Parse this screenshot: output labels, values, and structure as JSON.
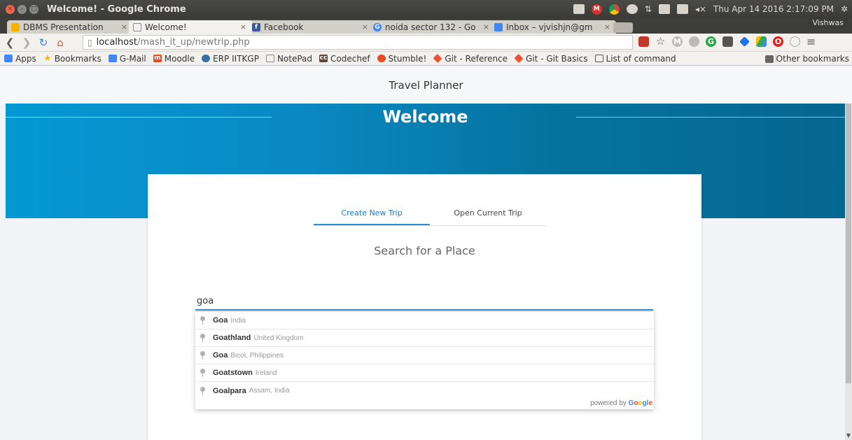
{
  "os": {
    "window_title": "Welcome! - Google Chrome",
    "clock": "Thu Apr 14 2016 2:17:09 PM",
    "user": "Vishwas"
  },
  "browser": {
    "tabs": [
      {
        "label": "DBMS Presentation",
        "favicon": "slides-icon",
        "color": "#f4b400"
      },
      {
        "label": "Welcome!",
        "favicon": "page-icon",
        "color": "#888888"
      },
      {
        "label": "Facebook",
        "favicon": "facebook-icon",
        "color": "#3b5998"
      },
      {
        "label": "noida sector 132 - Go",
        "favicon": "google-icon",
        "color": "#4285f4"
      },
      {
        "label": "Inbox – vjvishjn@gm",
        "favicon": "inbox-icon",
        "color": "#4285f4"
      }
    ],
    "url_host": "localhost",
    "url_path": "/mash_it_up/newtrip.php",
    "bookmarks": [
      {
        "label": "Apps",
        "icon": "apps-icon",
        "color": "#4285f4"
      },
      {
        "label": "Bookmarks",
        "icon": "star-icon",
        "color": "#f4b400"
      },
      {
        "label": "G-Mail",
        "icon": "gmail-icon",
        "color": "#4285f4"
      },
      {
        "label": "Moodle",
        "icon": "moodle-icon",
        "color": "#e04e2d"
      },
      {
        "label": "ERP IITKGP",
        "icon": "erp-icon",
        "color": "#3a6ea5"
      },
      {
        "label": "NotePad",
        "icon": "page-icon",
        "color": "#888888"
      },
      {
        "label": "Codechef",
        "icon": "codechef-icon",
        "color": "#5b4638"
      },
      {
        "label": "Stumble!",
        "icon": "stumble-icon",
        "color": "#eb4924"
      },
      {
        "label": "Git - Reference",
        "icon": "git-icon",
        "color": "#f05033"
      },
      {
        "label": "Git - Git Basics",
        "icon": "git-icon",
        "color": "#f05033"
      },
      {
        "label": "List of command",
        "icon": "list-icon",
        "color": "#555555"
      }
    ],
    "other_bookmarks": "Other bookmarks"
  },
  "page": {
    "app_title": "Travel Planner",
    "hero_title": "Welcome",
    "tabs": [
      {
        "label": "Create New Trip",
        "active": true
      },
      {
        "label": "Open Current Trip",
        "active": false
      }
    ],
    "search_heading": "Search for a Place",
    "search_value": "goa",
    "suggestions": [
      {
        "match": "Goa",
        "rest": "",
        "secondary": "India"
      },
      {
        "match": "Goa",
        "rest": "thland",
        "secondary": "United Kingdom"
      },
      {
        "match": "Goa",
        "rest": "",
        "secondary": "Bicol, Philippines"
      },
      {
        "match": "Goa",
        "rest": "tstown",
        "secondary": "Ireland"
      },
      {
        "match": "Goa",
        "rest": "lpara",
        "secondary": "Assam, India"
      }
    ],
    "powered_by": "powered by",
    "google_letters": [
      "G",
      "o",
      "o",
      "g",
      "l",
      "e"
    ],
    "accent_color": "#2a8ed6",
    "hero_colors": [
      "#0499d4",
      "#05678f"
    ]
  }
}
